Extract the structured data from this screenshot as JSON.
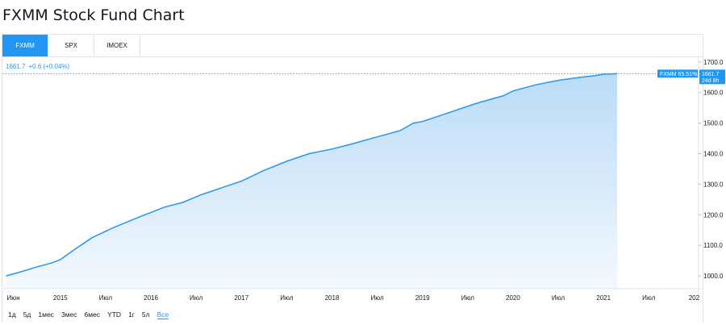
{
  "page": {
    "title": "FXMM Stock Fund Chart"
  },
  "tabs": [
    {
      "label": "FXMM",
      "active": true
    },
    {
      "label": "SPX",
      "active": false
    },
    {
      "label": "IMOEX",
      "active": false
    }
  ],
  "legend": {
    "price": "1661.7",
    "change": "+0.6 (+0.04%)"
  },
  "price_badge": {
    "series_label": "FXMM 65.51%",
    "value": "1661.7",
    "countdown": "24d 8h"
  },
  "ranges": [
    {
      "label": "1д",
      "active": false
    },
    {
      "label": "5д",
      "active": false
    },
    {
      "label": "1мес",
      "active": false
    },
    {
      "label": "3мес",
      "active": false
    },
    {
      "label": "6мес",
      "active": false
    },
    {
      "label": "YTD",
      "active": false
    },
    {
      "label": "1г",
      "active": false
    },
    {
      "label": "5л",
      "active": false
    },
    {
      "label": "Все",
      "active": true
    }
  ],
  "colors": {
    "accent": "#2196f3",
    "line": "#2196f3",
    "fill_top": "#bbdcf7",
    "fill_bottom": "#f3f8fd",
    "tab_active": "#2196f3"
  },
  "chart_data": {
    "type": "area",
    "series": [
      {
        "name": "FXMM",
        "x": [
          2014.4,
          2014.55,
          2014.75,
          2014.9,
          2015.0,
          2015.15,
          2015.35,
          2015.6,
          2015.85,
          2016.15,
          2016.35,
          2016.55,
          2016.75,
          2017.0,
          2017.25,
          2017.5,
          2017.75,
          2018.0,
          2018.2,
          2018.5,
          2018.75,
          2018.9,
          2019.0,
          2019.3,
          2019.6,
          2019.9,
          2020.0,
          2020.25,
          2020.5,
          2020.75,
          2020.9,
          2021.0,
          2021.1,
          2021.15
        ],
        "y": [
          1000,
          1012,
          1030,
          1042,
          1053,
          1085,
          1125,
          1160,
          1190,
          1225,
          1240,
          1265,
          1285,
          1310,
          1345,
          1375,
          1400,
          1415,
          1430,
          1455,
          1475,
          1500,
          1505,
          1535,
          1565,
          1590,
          1605,
          1625,
          1640,
          1650,
          1655,
          1660,
          1661,
          1661.7
        ]
      }
    ],
    "x_ticks": [
      {
        "x": 2014.4,
        "label": "Июн"
      },
      {
        "x": 2015.0,
        "label": "2015"
      },
      {
        "x": 2015.5,
        "label": "Июл"
      },
      {
        "x": 2016.0,
        "label": "2016"
      },
      {
        "x": 2016.5,
        "label": "Июл"
      },
      {
        "x": 2017.0,
        "label": "2017"
      },
      {
        "x": 2017.5,
        "label": "Июл"
      },
      {
        "x": 2018.0,
        "label": "2018"
      },
      {
        "x": 2018.5,
        "label": "Июл"
      },
      {
        "x": 2019.0,
        "label": "2019"
      },
      {
        "x": 2019.5,
        "label": "Июл"
      },
      {
        "x": 2020.0,
        "label": "2020"
      },
      {
        "x": 2020.5,
        "label": "Июл"
      },
      {
        "x": 2021.0,
        "label": "2021"
      },
      {
        "x": 2021.5,
        "label": "Июл"
      },
      {
        "x": 2022.0,
        "label": "202"
      }
    ],
    "y_ticks": [
      {
        "y": 1000,
        "label": "1000.0"
      },
      {
        "y": 1100,
        "label": "1100.0"
      },
      {
        "y": 1200,
        "label": "1200.0"
      },
      {
        "y": 1300,
        "label": "1300.0"
      },
      {
        "y": 1400,
        "label": "1400.0"
      },
      {
        "y": 1500,
        "label": "1500.0"
      },
      {
        "y": 1600,
        "label": "1600.0"
      },
      {
        "y": 1700,
        "label": "1700.0"
      }
    ],
    "xlim": [
      2014.36,
      2022.05
    ],
    "ylim": [
      958,
      1718
    ],
    "last_value": 1661.7,
    "grid": false
  }
}
